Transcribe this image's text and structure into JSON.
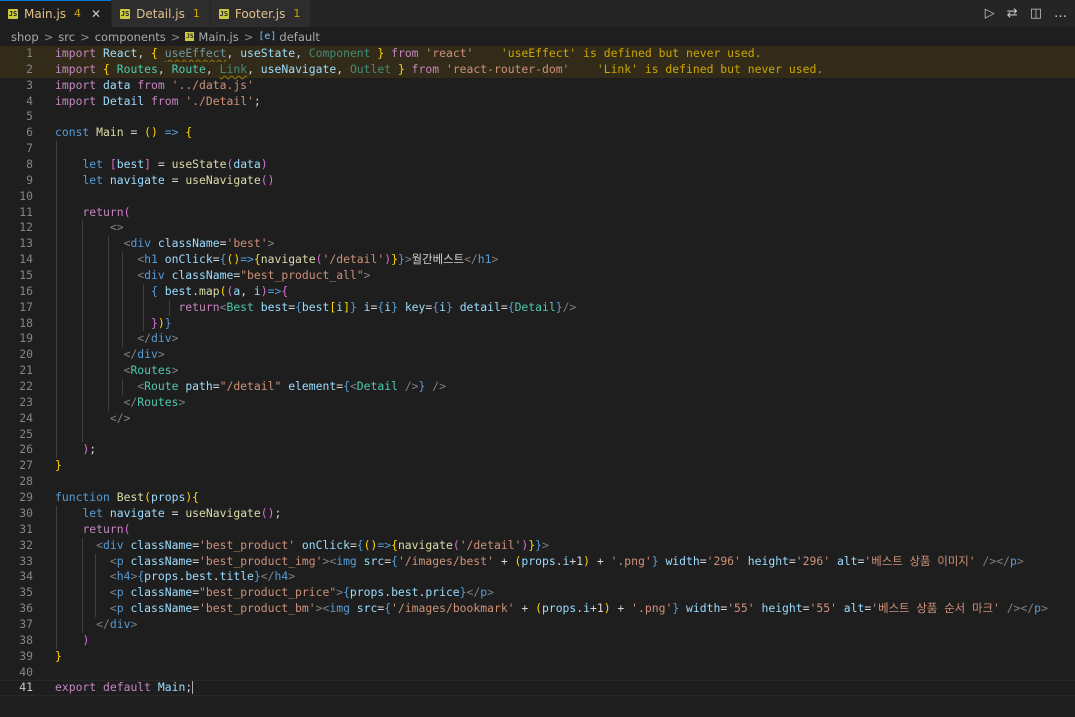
{
  "tabs": [
    {
      "name": "Main.js",
      "count": "4",
      "close": "✕",
      "active": true
    },
    {
      "name": "Detail.js",
      "count": "1",
      "active": false
    },
    {
      "name": "Footer.js",
      "count": "1",
      "active": false
    }
  ],
  "tab_actions": {
    "run_icon": "▷",
    "compare_icon": "⇄",
    "split_icon": "◫",
    "more_icon": "…"
  },
  "breadcrumb": {
    "items": [
      "shop",
      "src",
      "components",
      "Main.js",
      "default"
    ],
    "separator": ">",
    "file_icon_text": "JS",
    "symbol_icon_text": "[e]"
  },
  "editor": {
    "line_numbers": [
      "1",
      "2",
      "3",
      "4",
      "5",
      "6",
      "7",
      "8",
      "9",
      "10",
      "11",
      "12",
      "13",
      "14",
      "15",
      "16",
      "17",
      "18",
      "19",
      "20",
      "21",
      "22",
      "23",
      "24",
      "25",
      "26",
      "27",
      "28",
      "29",
      "30",
      "31",
      "32",
      "33",
      "34",
      "35",
      "36",
      "37",
      "38",
      "39",
      "40",
      "41"
    ],
    "diagnostics": {
      "line1": "'useEffect' is defined but never used.",
      "line2": "'Link' is defined but never used."
    },
    "text": {
      "h1_text": "월간베스트",
      "alt_best_img": "'베스트 상품 이미지'",
      "alt_bookmark": "'베스트 상품 순서 마크'"
    }
  },
  "colors": {
    "background": "#1e1e1e",
    "keyword": "#c586c0",
    "storage": "#569cd6",
    "variable": "#9cdcfe",
    "function": "#dcdcaa",
    "string": "#ce9178",
    "component": "#4ec9b0",
    "warning": "#cca700"
  }
}
